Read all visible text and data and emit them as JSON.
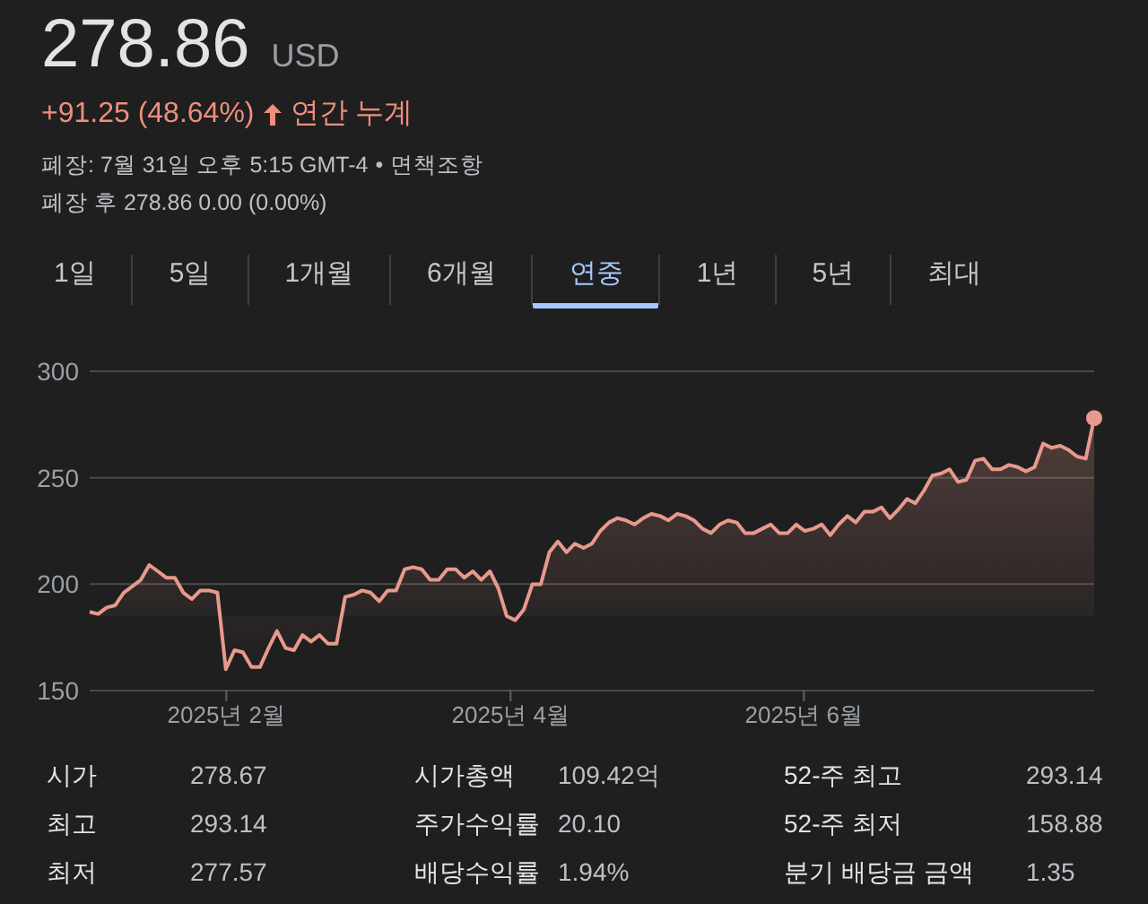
{
  "quote": {
    "price": "278.86",
    "currency": "USD",
    "change": "+91.25 (48.64%)",
    "period": "연간 누계",
    "close_info": "폐장: 7월 31일 오후 5:15 GMT-4",
    "separator": "•",
    "disclaimer": "면책조항",
    "after_hours": "폐장 후 278.86 0.00 (0.00%)"
  },
  "tabs": [
    {
      "label": "1일",
      "selected": false
    },
    {
      "label": "5일",
      "selected": false
    },
    {
      "label": "1개월",
      "selected": false
    },
    {
      "label": "6개월",
      "selected": false
    },
    {
      "label": "연중",
      "selected": true
    },
    {
      "label": "1년",
      "selected": false
    },
    {
      "label": "5년",
      "selected": false
    },
    {
      "label": "최대",
      "selected": false
    }
  ],
  "chart": {
    "x_labels": [
      "2025년 2월",
      "2025년 4월",
      "2025년 6월"
    ],
    "chart_data": {
      "type": "area",
      "ylim": [
        150,
        300
      ],
      "yticks": [
        150,
        200,
        250,
        300
      ],
      "series": [
        {
          "color": "#e8998d",
          "values": [
            187,
            186,
            189,
            190,
            196,
            199,
            202,
            209,
            206,
            203,
            203,
            196,
            193,
            197,
            197,
            196,
            160,
            169,
            168,
            161,
            161,
            170,
            178,
            170,
            169,
            176,
            173,
            176,
            172,
            172,
            194,
            195,
            197,
            196,
            192,
            197,
            197,
            207,
            208,
            207,
            202,
            202,
            207,
            207,
            203,
            206,
            202,
            206,
            198,
            185,
            183,
            188,
            200,
            200,
            215,
            220,
            215,
            219,
            217,
            219,
            225,
            229,
            231,
            230,
            228,
            231,
            233,
            232,
            230,
            233,
            232,
            230,
            226,
            224,
            228,
            230,
            229,
            224,
            224,
            226,
            228,
            224,
            224,
            228,
            225,
            226,
            228,
            223,
            228,
            232,
            229,
            234,
            234,
            236,
            231,
            235,
            240,
            238,
            244,
            251,
            252,
            254,
            248,
            249,
            258,
            259,
            254,
            254,
            256,
            255,
            253,
            255,
            266,
            264,
            265,
            263,
            260,
            259,
            278
          ]
        }
      ]
    }
  },
  "stats": [
    [
      {
        "label": "시가",
        "value": "278.67"
      },
      {
        "label": "시가총액",
        "value": "109.42억"
      },
      {
        "label": "52-주 최고",
        "value": "293.14"
      }
    ],
    [
      {
        "label": "최고",
        "value": "293.14"
      },
      {
        "label": "주가수익률",
        "value": "20.10"
      },
      {
        "label": "52-주 최저",
        "value": "158.88"
      }
    ],
    [
      {
        "label": "최저",
        "value": "277.57"
      },
      {
        "label": "배당수익률",
        "value": "1.94%"
      },
      {
        "label": "분기 배당금 금액",
        "value": "1.35"
      }
    ]
  ]
}
